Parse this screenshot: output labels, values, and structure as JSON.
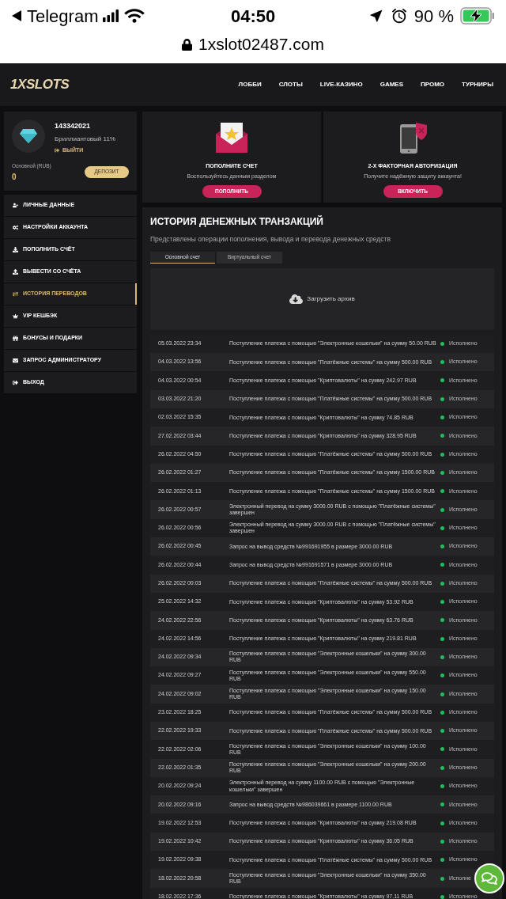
{
  "status_bar": {
    "back_app": "Telegram",
    "time": "04:50",
    "battery": "90 %"
  },
  "address_bar": {
    "url": "1xslot02487.com"
  },
  "header": {
    "logo": "1XSLOTS",
    "nav": [
      "ЛОББИ",
      "СЛОТЫ",
      "LIVE-КАЗИНО",
      "GAMES",
      "ПРОМО",
      "ТУРНИРЫ"
    ]
  },
  "profile": {
    "user_id": "143342021",
    "level": "Бриллиантовый 11%",
    "logout": "ВЫЙТИ",
    "balance_label": "Основной (RUB)",
    "balance": "0",
    "deposit_button": "ДЕПОЗИТ"
  },
  "sidebar": {
    "items": [
      {
        "label": "ЛИЧНЫЕ ДАННЫЕ",
        "selected": false
      },
      {
        "label": "НАСТРОЙКИ АККАУНТА",
        "selected": false
      },
      {
        "label": "ПОПОЛНИТЬ СЧЁТ",
        "selected": false
      },
      {
        "label": "ВЫВЕСТИ СО СЧЁТА",
        "selected": false
      },
      {
        "label": "ИСТОРИЯ ПЕРЕВОДОВ",
        "selected": true
      },
      {
        "label": "VIP КЕШБЭК",
        "selected": false
      },
      {
        "label": "БОНУСЫ И ПОДАРКИ",
        "selected": false
      },
      {
        "label": "ЗАПРОС АДМИНИСТРАТОРУ",
        "selected": false
      },
      {
        "label": "ВЫХОД",
        "selected": false
      }
    ]
  },
  "promo_cards": [
    {
      "kind": "envelope",
      "title": "ПОПОЛНИТЕ СЧЕТ",
      "subtitle": "Воспользуйтесь данным разделом",
      "button": "ПОПОЛНИТЬ"
    },
    {
      "kind": "phone",
      "title": "2-Х ФАКТОРНАЯ АВТОРИЗАЦИЯ",
      "subtitle": "Получите надёжную защиту аккаунта!",
      "button": "ВКЛЮЧИТЬ"
    }
  ],
  "history": {
    "title": "ИСТОРИЯ ДЕНЕЖНЫХ ТРАНЗАКЦИЙ",
    "subtitle": "Представлены операции пополнения, вывода и перевода денежных средств",
    "tabs": [
      {
        "label": "Основной счет",
        "selected": true
      },
      {
        "label": "Виртуальный счет",
        "selected": false
      }
    ],
    "archive_button": "Загрузить архив",
    "rows": [
      {
        "date": "05.03.2022 23:34",
        "description": "Поступление платежа с помощью \"Электронные кошельки\" на сумму 50.00 RUB",
        "status": "Исполнено"
      },
      {
        "date": "04.03.2022 13:56",
        "description": "Поступление платежа с помощью \"Платёжные системы\" на сумму 500.00 RUB",
        "status": "Исполнено"
      },
      {
        "date": "04.03.2022 00:54",
        "description": "Поступление платежа с помощью \"Криптовалюты\" на сумму 242.97 RUB",
        "status": "Исполнено"
      },
      {
        "date": "03.03.2022 21:20",
        "description": "Поступление платежа с помощью \"Платёжные системы\" на сумму 500.00 RUB",
        "status": "Исполнено"
      },
      {
        "date": "02.03.2022 15:35",
        "description": "Поступление платежа с помощью \"Криптовалюты\" на сумму 74.85 RUB",
        "status": "Исполнено"
      },
      {
        "date": "27.02.2022 03:44",
        "description": "Поступление платежа с помощью \"Криптовалюты\" на сумму 328.95 RUB",
        "status": "Исполнено"
      },
      {
        "date": "26.02.2022 04:50",
        "description": "Поступление платежа с помощью \"Платёжные системы\" на сумму 500.00 RUB",
        "status": "Исполнено"
      },
      {
        "date": "26.02.2022 01:27",
        "description": "Поступление платежа с помощью \"Платёжные системы\" на сумму 1500.00 RUB",
        "status": "Исполнено"
      },
      {
        "date": "26.02.2022 01:13",
        "description": "Поступление платежа с помощью \"Платёжные системы\" на сумму 1500.00 RUB",
        "status": "Исполнено"
      },
      {
        "date": "26.02.2022 00:57",
        "description": "Электронный перевод на сумму 3000.00 RUB с помощью \"Платёжные системы\" завершен",
        "status": "Исполнено"
      },
      {
        "date": "26.02.2022 00:56",
        "description": "Электронный перевод на сумму 3000.00 RUB с помощью \"Платёжные системы\" завершен",
        "status": "Исполнено"
      },
      {
        "date": "26.02.2022 00:45",
        "description": "Запрос на вывод средств №991691955 в размере 3000.00 RUB",
        "status": "Исполнено"
      },
      {
        "date": "26.02.2022 00:44",
        "description": "Запрос на вывод средств №991691571 в размере 3000.00 RUB",
        "status": "Исполнено"
      },
      {
        "date": "26.02.2022 00:03",
        "description": "Поступление платежа с помощью \"Платёжные системы\" на сумму 500.00 RUB",
        "status": "Исполнено"
      },
      {
        "date": "25.02.2022 14:32",
        "description": "Поступление платежа с помощью \"Криптовалюты\" на сумму 53.92 RUB",
        "status": "Исполнено"
      },
      {
        "date": "24.02.2022 22:56",
        "description": "Поступление платежа с помощью \"Криптовалюты\" на сумму 63.76 RUB",
        "status": "Исполнено"
      },
      {
        "date": "24.02.2022 14:56",
        "description": "Поступление платежа с помощью \"Криптовалюты\" на сумму 219.81 RUB",
        "status": "Исполнено"
      },
      {
        "date": "24.02.2022 09:34",
        "description": "Поступление платежа с помощью \"Электронные кошельки\" на сумму 300.00 RUB",
        "status": "Исполнено"
      },
      {
        "date": "24.02.2022 09:27",
        "description": "Поступление платежа с помощью \"Электронные кошельки\" на сумму 550.00 RUB",
        "status": "Исполнено"
      },
      {
        "date": "24.02.2022 09:02",
        "description": "Поступление платежа с помощью \"Электронные кошельки\" на сумму 150.00 RUB",
        "status": "Исполнено"
      },
      {
        "date": "23.02.2022 18:25",
        "description": "Поступление платежа с помощью \"Платёжные системы\" на сумму 500.00 RUB",
        "status": "Исполнено"
      },
      {
        "date": "22.02.2022 19:33",
        "description": "Поступление платежа с помощью \"Платёжные системы\" на сумму 500.00 RUB",
        "status": "Исполнено"
      },
      {
        "date": "22.02.2022 02:06",
        "description": "Поступление платежа с помощью \"Электронные кошельки\" на сумму 100.00 RUB",
        "status": "Исполнено"
      },
      {
        "date": "22.02.2022 01:35",
        "description": "Поступление платежа с помощью \"Электронные кошельки\" на сумму 200.00 RUB",
        "status": "Исполнено"
      },
      {
        "date": "20.02.2022 09:24",
        "description": "Электронный перевод на сумму 1100.00 RUB с помощью \"Электронные кошельки\" завершен",
        "status": "Исполнено"
      },
      {
        "date": "20.02.2022 09:16",
        "description": "Запрос на вывод средств №986039661 в размере 1100.00 RUB",
        "status": "Исполнено"
      },
      {
        "date": "19.02.2022 12:53",
        "description": "Поступление платежа с помощью \"Криптовалюты\" на сумму 219.08 RUB",
        "status": "Исполнено"
      },
      {
        "date": "19.02.2022 10:42",
        "description": "Поступление платежа с помощью \"Криптовалюты\" на сумму 36.05 RUB",
        "status": "Исполнено"
      },
      {
        "date": "19.02.2022 09:38",
        "description": "Поступление платежа с помощью \"Платёжные системы\" на сумму 500.00 RUB",
        "status": "Исполнено"
      },
      {
        "date": "18.02.2022 20:58",
        "description": "Поступление платежа с помощью \"Электронные кошельки\" на сумму 350.00 RUB",
        "status": "Исполне"
      },
      {
        "date": "18.02.2022 17:36",
        "description": "Поступление платежа с помощью \"Криптовалюты\" на сумму 97.11 RUB",
        "status": "Исполнено"
      }
    ]
  }
}
